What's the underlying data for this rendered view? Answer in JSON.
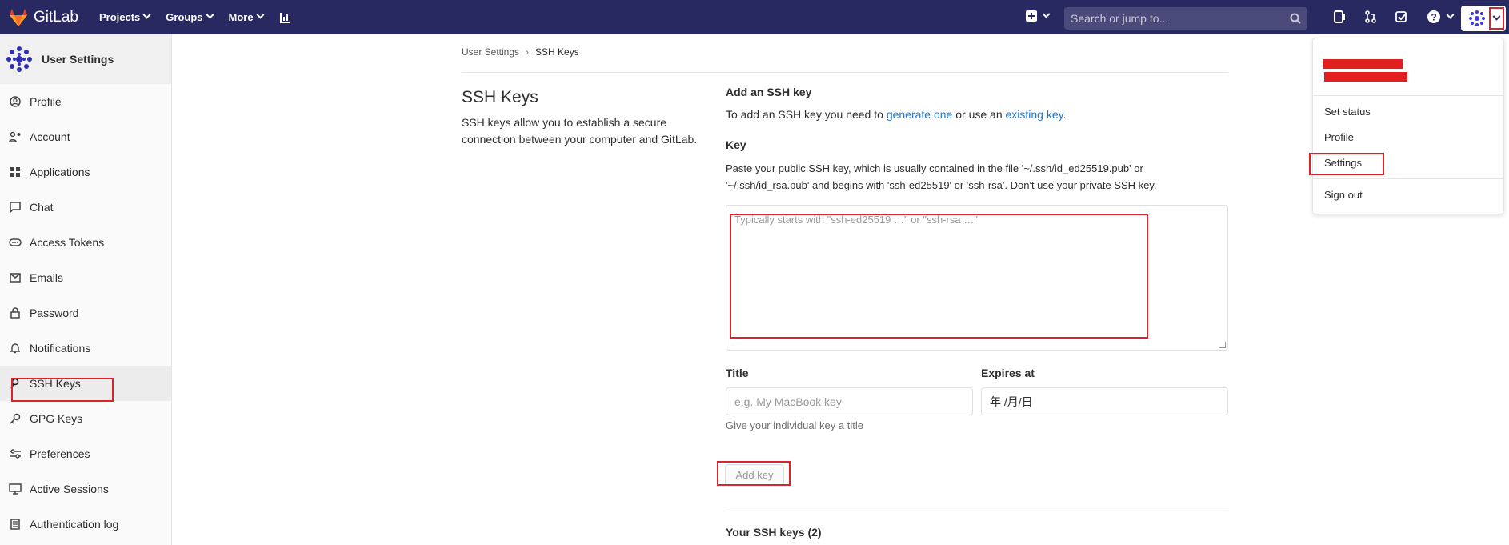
{
  "navbar": {
    "brand": "GitLab",
    "menus": [
      {
        "label": "Projects"
      },
      {
        "label": "Groups"
      },
      {
        "label": "More"
      }
    ],
    "search_placeholder": "Search or jump to...",
    "bg_color": "#292961"
  },
  "sidebar": {
    "title": "User Settings",
    "items": [
      {
        "label": "Profile",
        "icon": "profile-icon"
      },
      {
        "label": "Account",
        "icon": "account-icon"
      },
      {
        "label": "Applications",
        "icon": "applications-icon"
      },
      {
        "label": "Chat",
        "icon": "chat-icon"
      },
      {
        "label": "Access Tokens",
        "icon": "access-tokens-icon"
      },
      {
        "label": "Emails",
        "icon": "email-icon"
      },
      {
        "label": "Password",
        "icon": "lock-icon"
      },
      {
        "label": "Notifications",
        "icon": "bell-icon"
      },
      {
        "label": "SSH Keys",
        "icon": "key-icon",
        "active": true
      },
      {
        "label": "GPG Keys",
        "icon": "gpg-key-icon"
      },
      {
        "label": "Preferences",
        "icon": "preferences-icon"
      },
      {
        "label": "Active Sessions",
        "icon": "monitor-icon"
      },
      {
        "label": "Authentication log",
        "icon": "log-icon"
      }
    ]
  },
  "breadcrumb": {
    "parent": "User Settings",
    "sep": "›",
    "current": "SSH Keys"
  },
  "page": {
    "title": "SSH Keys",
    "description": "SSH keys allow you to establish a secure connection between your computer and GitLab."
  },
  "form": {
    "section_title": "Add an SSH key",
    "intro_prefix": "To add an SSH key you need to ",
    "intro_link1": "generate one",
    "intro_mid": " or use an ",
    "intro_link2": "existing key",
    "intro_suffix": ".",
    "key_label": "Key",
    "key_help": "Paste your public SSH key, which is usually contained in the file '~/.ssh/id_ed25519.pub' or '~/.ssh/id_rsa.pub' and begins with 'ssh-ed25519' or 'ssh-rsa'. Don't use your private SSH key.",
    "key_placeholder": "Typically starts with \"ssh-ed25519 …\" or \"ssh-rsa …\"",
    "title_label": "Title",
    "title_placeholder": "e.g. My MacBook key",
    "expires_label": "Expires at",
    "expires_value": "年 /月/日",
    "title_hint": "Give your individual key a title",
    "add_button": "Add key",
    "your_keys": "Your SSH keys (2)"
  },
  "dropdown": {
    "items": [
      "Set status",
      "Profile",
      "Settings",
      "Sign out"
    ]
  },
  "colors": {
    "link": "#1f78d1",
    "annotation": "#d9232d"
  }
}
